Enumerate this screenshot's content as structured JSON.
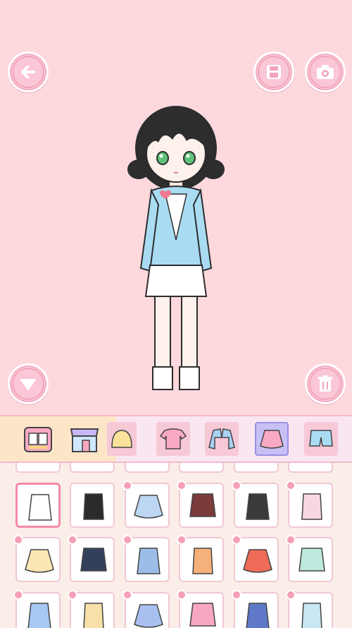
{
  "toolbar": {
    "back_icon": "back-arrow-icon",
    "save_icon": "save-icon",
    "camera_icon": "camera-icon",
    "collapse_icon": "chevron-down-icon",
    "trash_icon": "trash-icon"
  },
  "categories": [
    {
      "icon": "wardrobe-icon",
      "state": "pinned"
    },
    {
      "icon": "shop-icon",
      "state": "pinned"
    },
    {
      "icon": "hair-icon",
      "state": "plain"
    },
    {
      "icon": "top-icon",
      "state": "plain"
    },
    {
      "icon": "jacket-icon",
      "state": "plain"
    },
    {
      "icon": "skirt-icon",
      "state": "active"
    },
    {
      "icon": "shorts-icon",
      "state": "plain"
    }
  ],
  "items": [
    {
      "icon": "plain-white-skirt-icon",
      "color": "#ffffff",
      "selected": true
    },
    {
      "icon": "black-pencil-skirt-icon",
      "color": "#2b2b2b"
    },
    {
      "icon": "blue-gradient-skirt-icon",
      "color": "#bcd6f3"
    },
    {
      "icon": "plaid-tied-skirt-icon",
      "color": "#7b3b3b"
    },
    {
      "icon": "black-chain-skirt-icon",
      "color": "#3a3a3a"
    },
    {
      "icon": "pink-tulle-skirt-icon",
      "color": "#f9d7e2"
    },
    {
      "icon": "yellow-lace-skirt-icon",
      "color": "#fbe7b3"
    },
    {
      "icon": "navy-peach-top-icon",
      "color": "#33405c"
    },
    {
      "icon": "blue-long-skirt-icon",
      "color": "#9dbde9"
    },
    {
      "icon": "autumn-leaf-skirt-icon",
      "color": "#f6b07a"
    },
    {
      "icon": "red-ruffle-skirt-icon",
      "color": "#ef6b57"
    },
    {
      "icon": "mint-wrap-skirt-icon",
      "color": "#bfe8df"
    },
    {
      "icon": "blue-flower-skirt-icon",
      "color": "#a6c8f2"
    },
    {
      "icon": "yellow-wave-skirt-icon",
      "color": "#f8e1a8"
    },
    {
      "icon": "wave-pattern-skirt-icon",
      "color": "#a8bff0"
    },
    {
      "icon": "pink-long-skirt-icon",
      "color": "#f7a6c4"
    },
    {
      "icon": "blue-belt-skirt-icon",
      "color": "#5f79c8"
    },
    {
      "icon": "pastel-layer-skirt-icon",
      "color": "#c8e6f4"
    }
  ]
}
